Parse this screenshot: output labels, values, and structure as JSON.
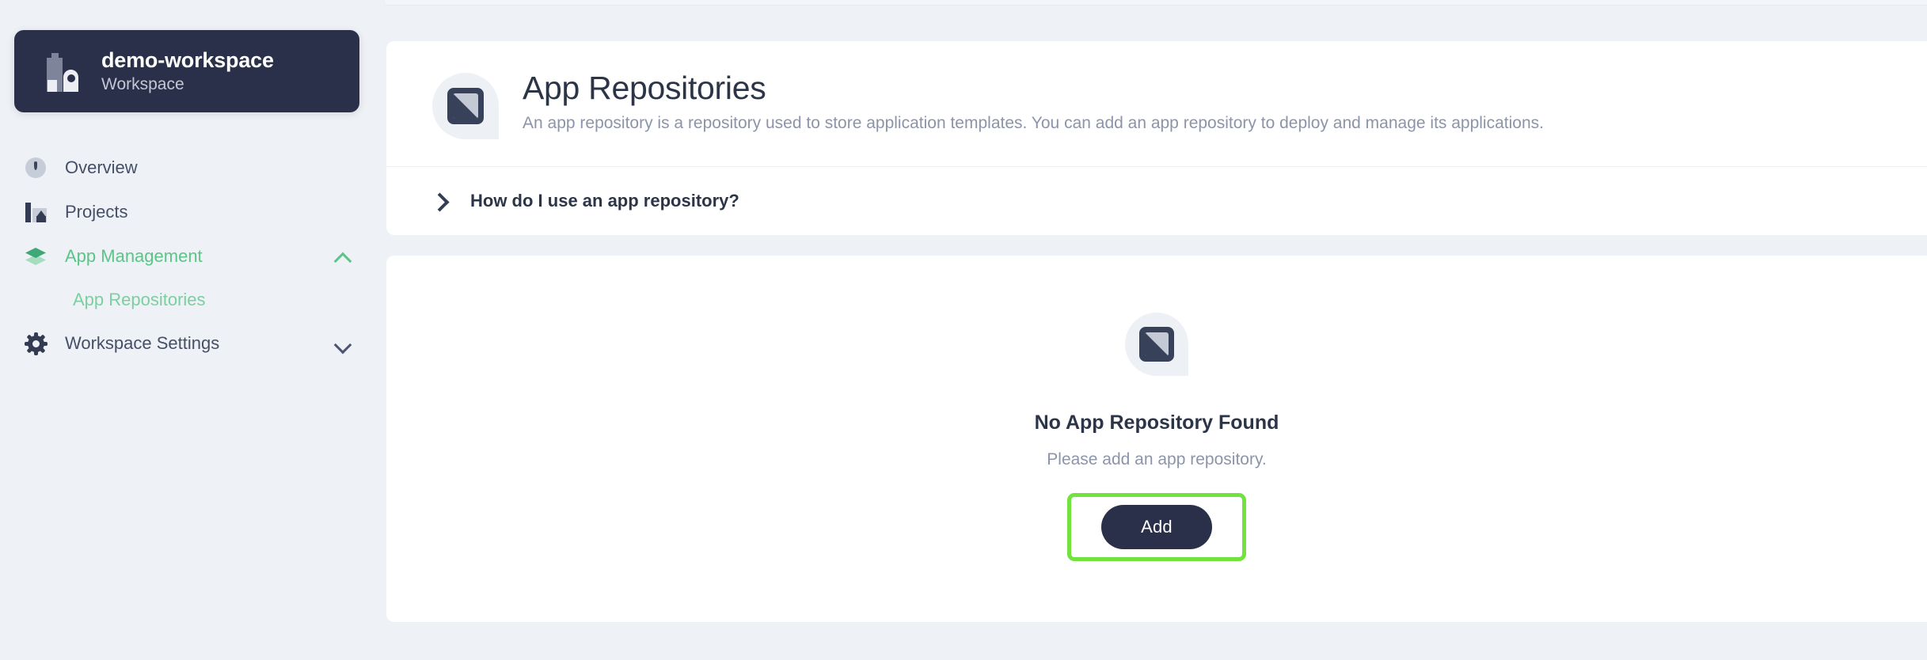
{
  "workspace": {
    "name": "demo-workspace",
    "subtitle": "Workspace",
    "logo_icon": "building-icon"
  },
  "sidebar": {
    "items": [
      {
        "label": "Overview",
        "icon": "gauge-icon",
        "active": false
      },
      {
        "label": "Projects",
        "icon": "projects-icon",
        "active": false
      },
      {
        "label": "App Management",
        "icon": "layers-icon",
        "active": true,
        "chevron": "chevron-up-icon"
      },
      {
        "label": "Workspace Settings",
        "icon": "gear-icon",
        "active": false,
        "chevron": "chevron-down-icon"
      }
    ],
    "sub_items": [
      {
        "label": "App Repositories",
        "active": true
      }
    ]
  },
  "header": {
    "icon": "app-repository-icon",
    "title": "App Repositories",
    "description": "An app repository is a repository used to store application templates. You can add an app repository to deploy and manage its applications."
  },
  "accordion": {
    "label": "How do I use an app repository?",
    "icon": "chevron-right-icon",
    "expanded": false
  },
  "empty_state": {
    "icon": "app-repository-icon",
    "title": "No App Repository Found",
    "subtitle": "Please add an app repository.",
    "add_label": "Add"
  },
  "colors": {
    "accent_green": "#5cc389",
    "highlight_green": "#72e23e",
    "dark_navy": "#2a3049",
    "sidebar_bg": "#eef1f5",
    "muted_text": "#8b94a9"
  }
}
